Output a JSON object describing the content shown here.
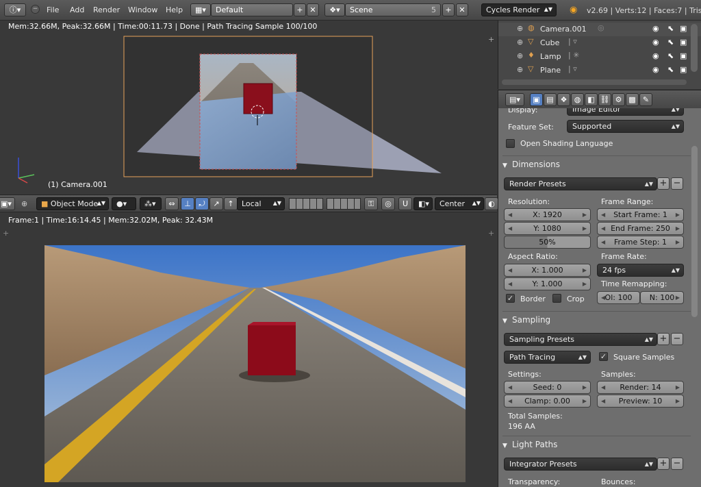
{
  "topbar": {
    "menus": [
      "File",
      "Add",
      "Render",
      "Window",
      "Help"
    ],
    "layout": "Default",
    "scene": "Scene",
    "scene_users": "5",
    "engine": "Cycles Render",
    "stats": "v2.69 | Verts:12 | Faces:7 | Tris:1"
  },
  "viewport": {
    "render_info": "Mem:32.66M, Peak:32.66M | Time:00:11.73 | Done | Path Tracing Sample 100/100",
    "object_label": "(1) Camera.001",
    "mode": "Object Mode",
    "orientation": "Local",
    "pivot": "Center"
  },
  "image_editor": {
    "info": "Frame:1 | Time:16:14.45 | Mem:32.02M, Peak: 32.43M"
  },
  "outliner": {
    "items": [
      {
        "name": "Camera.001",
        "icon": "camera-icon"
      },
      {
        "name": "Cube",
        "icon": "mesh-icon"
      },
      {
        "name": "Lamp",
        "icon": "lamp-icon"
      },
      {
        "name": "Plane",
        "icon": "mesh-icon"
      }
    ]
  },
  "properties": {
    "display_label": "Display:",
    "display_value": "Image Editor",
    "feature_set_label": "Feature Set:",
    "feature_set_value": "Supported",
    "osl_label": "Open Shading Language",
    "dimensions": {
      "title": "Dimensions",
      "presets": "Render Presets",
      "resolution_label": "Resolution:",
      "res_x": "X: 1920",
      "res_y": "Y: 1080",
      "res_pct": "50%",
      "frame_range_label": "Frame Range:",
      "start_frame": "Start Frame: 1",
      "end_frame": "End Frame: 250",
      "frame_step": "Frame Step: 1",
      "aspect_label": "Aspect Ratio:",
      "aspect_x": "X: 1.000",
      "aspect_y": "Y: 1.000",
      "frame_rate_label": "Frame Rate:",
      "frame_rate": "24 fps",
      "time_remap_label": "Time Remapping:",
      "remap_old": "Ol: 100",
      "remap_new": "N: 100",
      "border_label": "Border",
      "crop_label": "Crop"
    },
    "sampling": {
      "title": "Sampling",
      "presets": "Sampling Presets",
      "method": "Path Tracing",
      "square_samples": "Square Samples",
      "settings_label": "Settings:",
      "seed": "Seed: 0",
      "clamp": "Clamp: 0.00",
      "samples_label": "Samples:",
      "render": "Render: 14",
      "preview": "Preview: 10",
      "total_label": "Total Samples:",
      "total_value": "196 AA"
    },
    "light_paths": {
      "title": "Light Paths",
      "presets": "Integrator Presets",
      "transparency_label": "Transparency:",
      "bounces_label": "Bounces:"
    }
  }
}
